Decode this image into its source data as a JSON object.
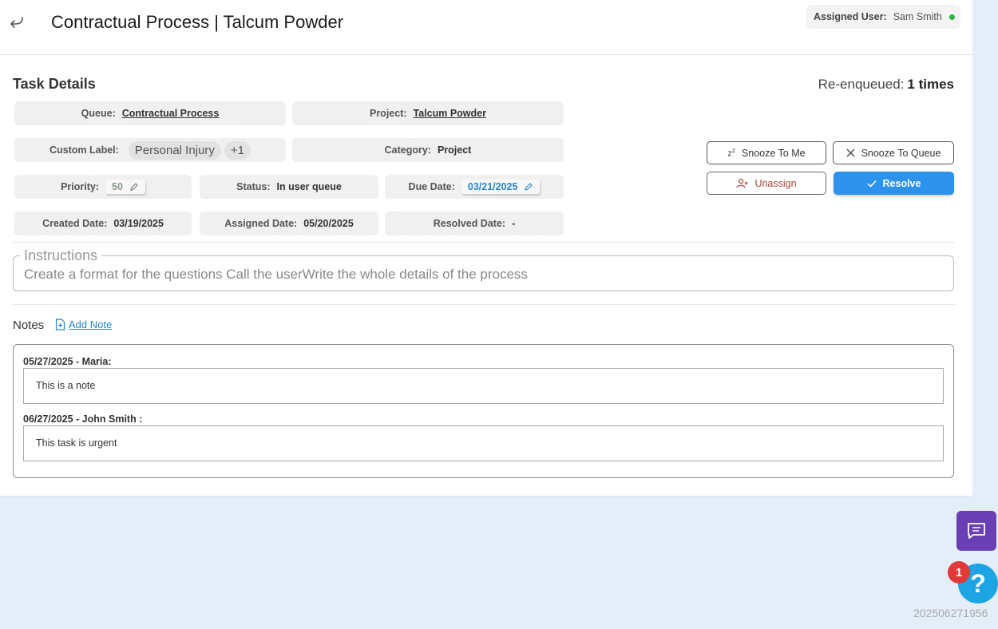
{
  "header": {
    "title": "Contractual Process | Talcum Powder",
    "assigned_user_label": "Assigned User:",
    "assigned_user_name": "Sam Smith",
    "status_color": "#36b24a"
  },
  "task": {
    "section_title": "Task Details",
    "reenqueued_label": "Re-enqueued:",
    "reenqueued_value": "1 times",
    "queue_label": "Queue:",
    "queue_value": "Contractual Process",
    "project_label": "Project:",
    "project_value": "Talcum Powder",
    "custom_label_label": "Custom Label:",
    "custom_label_value": "Personal Injury",
    "custom_label_more": "+1",
    "category_label": "Category:",
    "category_value": "Project",
    "priority_label": "Priority:",
    "priority_value": "50",
    "status_label": "Status:",
    "status_value": "In user queue",
    "due_label": "Due Date:",
    "due_value": "03/21/2025",
    "created_label": "Created Date:",
    "created_value": "03/19/2025",
    "assigned_label": "Assigned Date:",
    "assigned_value": "05/20/2025",
    "resolved_label": "Resolved Date:",
    "resolved_value": "-"
  },
  "actions": {
    "snooze_me": "Snooze To Me",
    "snooze_queue": "Snooze To Queue",
    "unassign": "Unassign",
    "resolve": "Resolve",
    "accent": "#2d92ec"
  },
  "instructions": {
    "legend": "Instructions",
    "text": "Create a format for the questions Call the userWrite the whole details of the process"
  },
  "notes": {
    "label": "Notes",
    "add_label": "Add Note",
    "items": [
      {
        "header": "05/27/2025 - Maria:",
        "body": "This is a note"
      },
      {
        "header": "06/27/2025 - John Smith :",
        "body": "This task is urgent"
      }
    ]
  },
  "widgets": {
    "help_badge": "1",
    "help_glyph": "?",
    "build_id": "202506271956"
  }
}
